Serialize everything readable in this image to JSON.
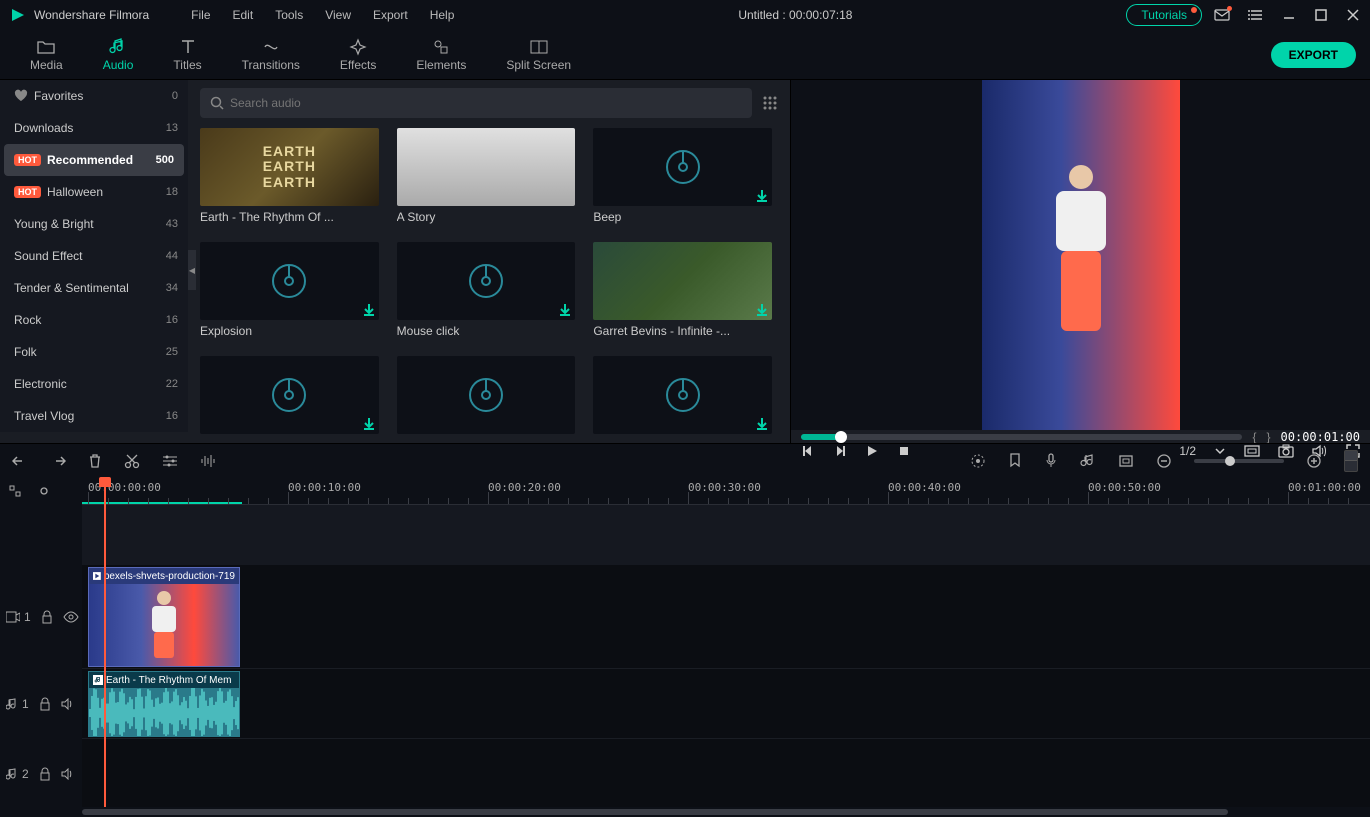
{
  "app": {
    "name": "Wondershare Filmora",
    "title": "Untitled : 00:00:07:18"
  },
  "menu": {
    "file": "File",
    "edit": "Edit",
    "tools": "Tools",
    "view": "View",
    "export": "Export",
    "help": "Help"
  },
  "topbar": {
    "tutorials": "Tutorials"
  },
  "tabs": {
    "media": "Media",
    "audio": "Audio",
    "titles": "Titles",
    "transitions": "Transitions",
    "effects": "Effects",
    "elements": "Elements",
    "split": "Split Screen",
    "export_btn": "EXPORT"
  },
  "sidebar": {
    "items": [
      {
        "label": "Favorites",
        "count": "0",
        "heart": true
      },
      {
        "label": "Downloads",
        "count": "13"
      },
      {
        "label": "Recommended",
        "count": "500",
        "hot": true,
        "selected": true
      },
      {
        "label": "Halloween",
        "count": "18",
        "hot": true
      },
      {
        "label": "Young & Bright",
        "count": "43"
      },
      {
        "label": "Sound Effect",
        "count": "44"
      },
      {
        "label": "Tender & Sentimental",
        "count": "34"
      },
      {
        "label": "Rock",
        "count": "16"
      },
      {
        "label": "Folk",
        "count": "25"
      },
      {
        "label": "Electronic",
        "count": "22"
      },
      {
        "label": "Travel Vlog",
        "count": "16"
      }
    ]
  },
  "search": {
    "placeholder": "Search audio"
  },
  "grid": {
    "items": [
      {
        "label": "Earth - The Rhythm Of ...",
        "kind": "earth"
      },
      {
        "label": "A Story",
        "kind": "story"
      },
      {
        "label": "Beep",
        "kind": "music",
        "dl": true
      },
      {
        "label": "Explosion",
        "kind": "music",
        "dl": true
      },
      {
        "label": "Mouse click",
        "kind": "music",
        "dl": true
      },
      {
        "label": "Garret Bevins - Infinite -...",
        "kind": "tropical",
        "dl": true
      },
      {
        "label": "",
        "kind": "music",
        "dl": true
      },
      {
        "label": "",
        "kind": "music"
      },
      {
        "label": "",
        "kind": "music",
        "dl": true
      }
    ]
  },
  "preview": {
    "time": "00:00:01:00",
    "frame_index": "1/2"
  },
  "ruler": {
    "ticks": [
      "00:00:00:00",
      "00:00:10:00",
      "00:00:20:00",
      "00:00:30:00",
      "00:00:40:00",
      "00:00:50:00",
      "00:01:00:00"
    ]
  },
  "timeline": {
    "video_clip": "pexels-shvets-production-719",
    "audio_clip": "Earth - The Rhythm Of Mem",
    "tracks": {
      "video1": "1",
      "audio1": "1",
      "audio2": "2"
    }
  },
  "earth_lines": {
    "l1": "EARTH",
    "l2": "EARTH",
    "l3": "EARTH"
  }
}
